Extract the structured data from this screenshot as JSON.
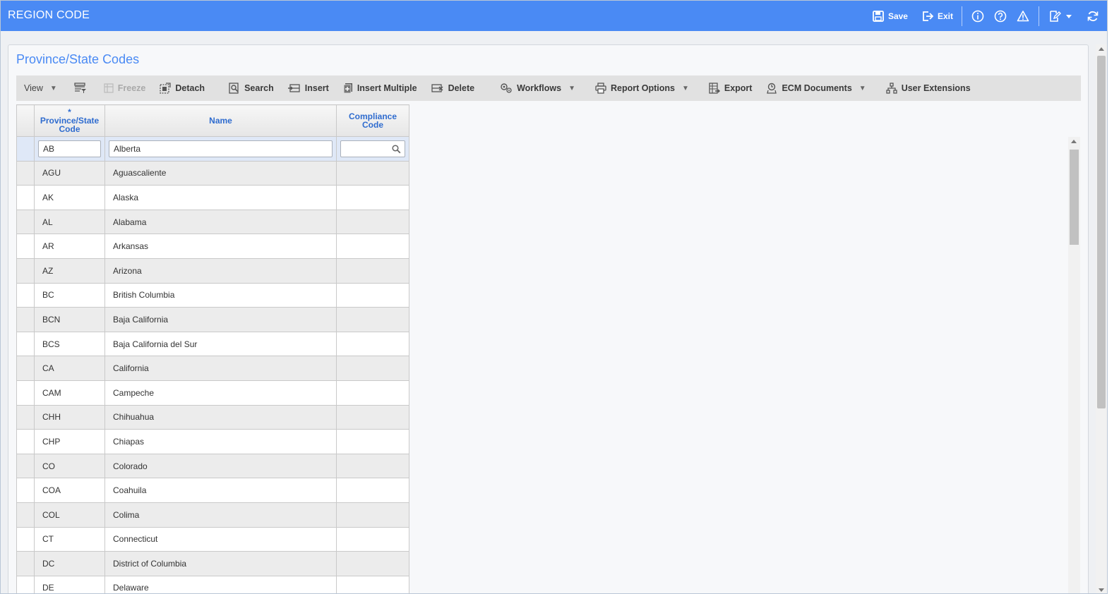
{
  "window": {
    "title": "REGION CODE"
  },
  "header_actions": {
    "save_label": "Save",
    "exit_label": "Exit"
  },
  "header_icons": [
    "info-icon",
    "help-icon",
    "warning-icon",
    "edit-note-icon",
    "chevron-down-icon",
    "refresh-icon"
  ],
  "panel": {
    "title": "Province/State Codes"
  },
  "toolbar": {
    "view_label": "View",
    "freeze_label": "Freeze",
    "detach_label": "Detach",
    "search_label": "Search",
    "insert_label": "Insert",
    "insert_multiple_label": "Insert Multiple",
    "delete_label": "Delete",
    "workflows_label": "Workflows",
    "report_options_label": "Report Options",
    "export_label": "Export",
    "ecm_documents_label": "ECM Documents",
    "user_extensions_label": "User Extensions"
  },
  "table": {
    "columns": {
      "code": "* Province/State Code",
      "name": "Name",
      "compliance": "Compliance Code"
    },
    "edit_row": {
      "code": "AB",
      "name": "Alberta",
      "compliance": ""
    },
    "rows": [
      {
        "code": "AGU",
        "name": "Aguascaliente",
        "compliance": ""
      },
      {
        "code": "AK",
        "name": "Alaska",
        "compliance": ""
      },
      {
        "code": "AL",
        "name": "Alabama",
        "compliance": ""
      },
      {
        "code": "AR",
        "name": "Arkansas",
        "compliance": ""
      },
      {
        "code": "AZ",
        "name": "Arizona",
        "compliance": ""
      },
      {
        "code": "BC",
        "name": "British Columbia",
        "compliance": ""
      },
      {
        "code": "BCN",
        "name": "Baja California",
        "compliance": ""
      },
      {
        "code": "BCS",
        "name": "Baja California del Sur",
        "compliance": ""
      },
      {
        "code": "CA",
        "name": "California",
        "compliance": ""
      },
      {
        "code": "CAM",
        "name": "Campeche",
        "compliance": ""
      },
      {
        "code": "CHH",
        "name": "Chihuahua",
        "compliance": ""
      },
      {
        "code": "CHP",
        "name": "Chiapas",
        "compliance": ""
      },
      {
        "code": "CO",
        "name": "Colorado",
        "compliance": ""
      },
      {
        "code": "COA",
        "name": "Coahuila",
        "compliance": ""
      },
      {
        "code": "COL",
        "name": "Colima",
        "compliance": ""
      },
      {
        "code": "CT",
        "name": "Connecticut",
        "compliance": ""
      },
      {
        "code": "DC",
        "name": "District of Columbia",
        "compliance": ""
      },
      {
        "code": "DE",
        "name": "Delaware",
        "compliance": ""
      }
    ]
  },
  "colors": {
    "header_bg": "#4a8af4",
    "title_blue": "#4a8af4",
    "column_header_text": "#2f6ccf",
    "active_row": "#dfe8f7"
  }
}
